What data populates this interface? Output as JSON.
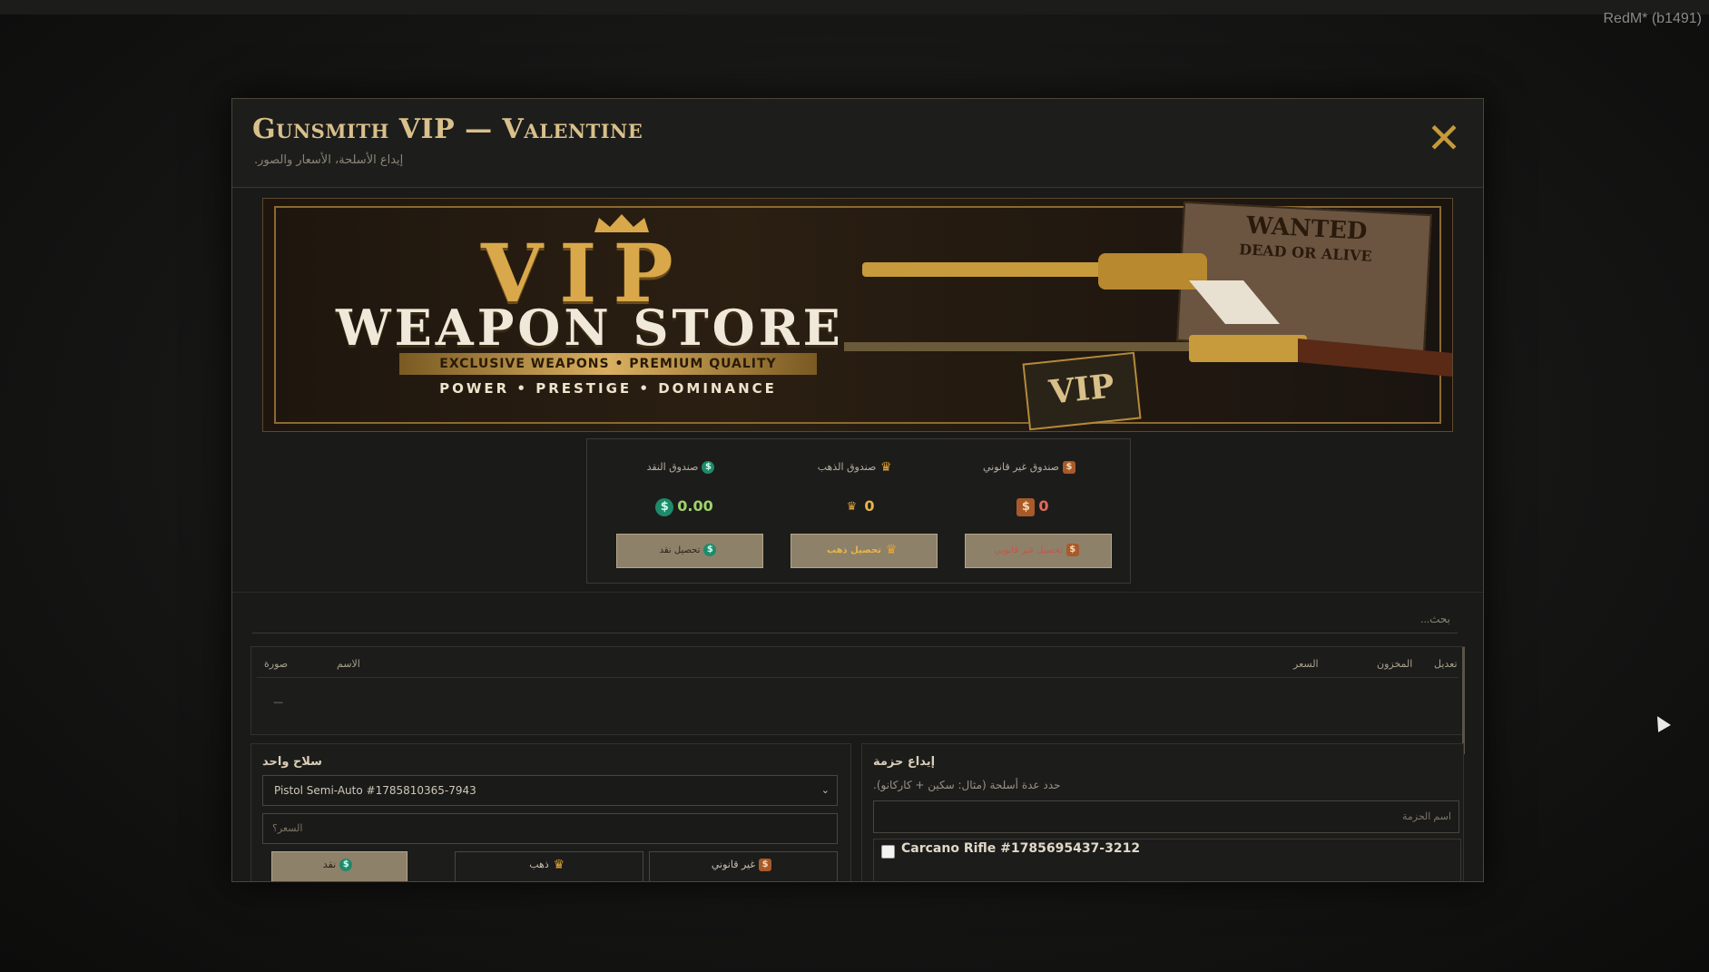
{
  "app": {
    "build_label": "RedM* (b1491)"
  },
  "modal": {
    "title": "Gunsmith VIP — Valentine",
    "subtitle": "إيداع الأسلحة، الأسعار والصور.",
    "close_label": "✕"
  },
  "banner": {
    "line1": "VIP",
    "line2": "WEAPON STORE",
    "ribbon": "EXCLUSIVE WEAPONS • PREMIUM QUALITY",
    "tagline": "POWER • PRESTIGE • DOMINANCE",
    "wanted": "WANTED",
    "wanted_sub": "DEAD OR ALIVE",
    "badge": "VIP"
  },
  "funds": {
    "cash": {
      "label": "صندوق النقد",
      "value": "0.00",
      "button": "تحصيل نقد",
      "color": "#9fd36a"
    },
    "gold": {
      "label": "صندوق الذهب",
      "value": "0",
      "button": "تحصيل ذهب",
      "color": "#e8b54a"
    },
    "illegal": {
      "label": "صندوق غير قانوني",
      "value": "0",
      "button": "تحصيل غير قانوني",
      "color": "#e06a5a"
    }
  },
  "search": {
    "placeholder": "بحث..."
  },
  "table": {
    "headers": {
      "image": "صورة",
      "name": "الاسم",
      "price": "السعر",
      "stock": "المخزون",
      "edit": "تعديل"
    },
    "empty_row": "—"
  },
  "single": {
    "title": "سلاح واحد",
    "selected_weapon": "Pistol Semi-Auto #1785810365-7943",
    "price_placeholder": "السعر؟",
    "buttons": {
      "cash": "نقد",
      "gold": "ذهب",
      "illegal": "غير قانوني"
    }
  },
  "bundle": {
    "title": "إيداع حزمة",
    "description": "حدد عدة أسلحة (مثال: سكين + كاركانو).",
    "name_placeholder": "اسم الحزمة",
    "items": [
      {
        "label": "Carcano Rifle #1785695437-3212",
        "checked": false
      }
    ]
  },
  "colors": {
    "accent": "#c69a3a",
    "button_bg": "#8e816a",
    "title": "#d9c08a"
  }
}
